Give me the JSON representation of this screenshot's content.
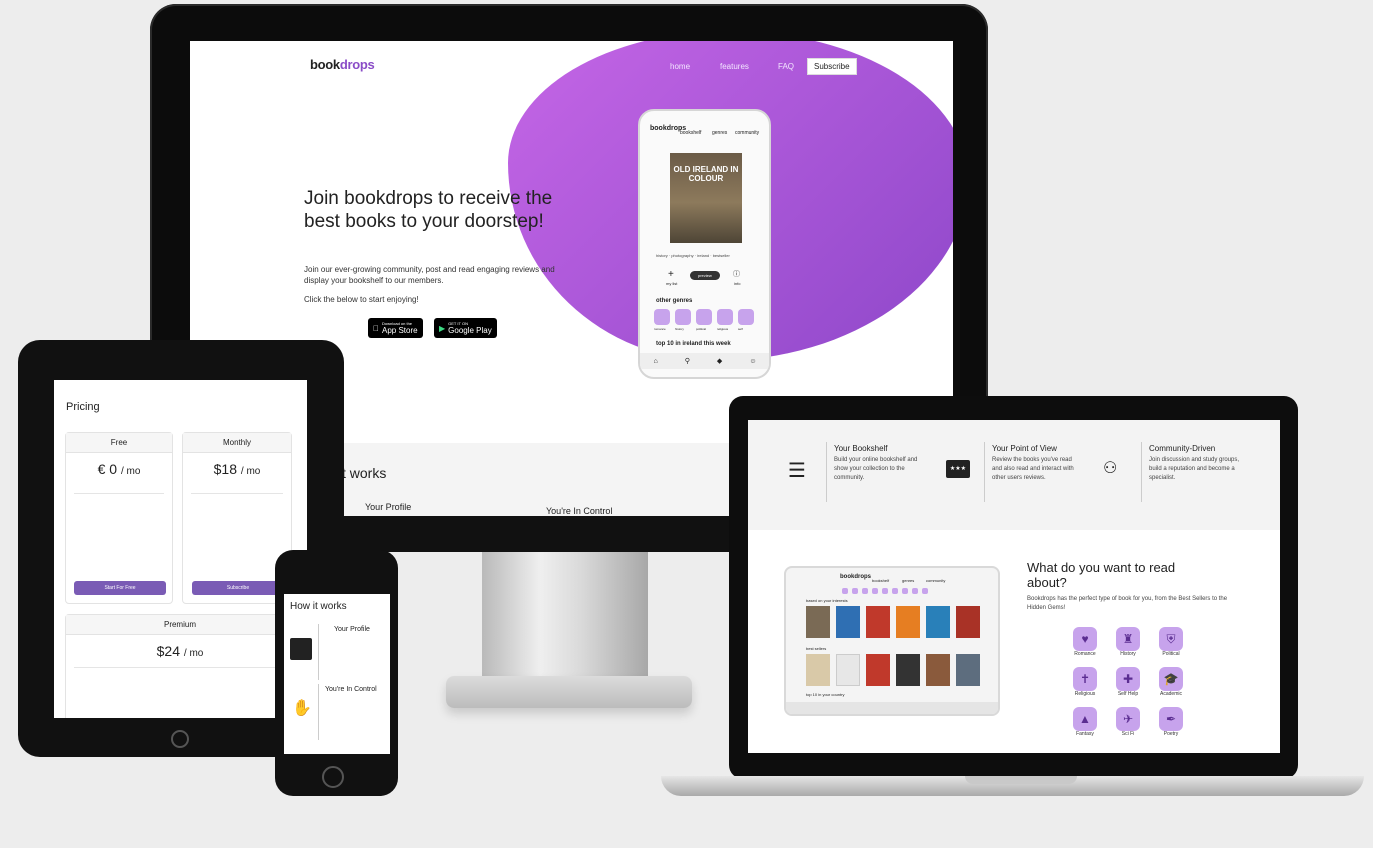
{
  "monitor": {
    "logo_a": "book",
    "logo_b": "drops",
    "nav": [
      "home",
      "features",
      "FAQ"
    ],
    "subscribe": "Subscribe",
    "hero_heading": "Join bookdrops to receive the best books to your doorstep!",
    "hero_text": "Join our ever-growing community, post and read engaging reviews and display your bookshelf to our members.",
    "hero_cta": "Click the below to start enjoying!",
    "app_store": "App Store",
    "app_store_small": "Download on the",
    "google_play": "Google Play",
    "google_play_small": "GET IT ON",
    "section_title": "t works",
    "section_item_1": "Your Profile",
    "section_item_2": "You're In Control",
    "phone": {
      "logo": "bookdrops",
      "tabs": [
        "bookshelf",
        "genres",
        "community"
      ],
      "book_title": "OLD IRELAND IN COLOUR",
      "tags": "history · photography · ireland · bestseller",
      "my_list": "my list",
      "preview": "preview",
      "info": "info",
      "other_genres": "other genres",
      "genres": [
        "romance",
        "history",
        "political",
        "religious",
        "self"
      ],
      "top10": "top 10 in ireland this week"
    }
  },
  "tablet": {
    "title": "Pricing",
    "plans": [
      {
        "name": "Free",
        "price": "€ 0",
        "period": "/ mo",
        "button": "Start For Free"
      },
      {
        "name": "Monthly",
        "price": "$18",
        "period": "/ mo",
        "button": "Subscribe"
      },
      {
        "name": "Premium",
        "price": "$24",
        "period": "/ mo"
      }
    ]
  },
  "phone": {
    "title": "How it works",
    "item_1": "Your Profile",
    "item_2": "You're In Control"
  },
  "laptop": {
    "features": [
      {
        "title": "Your Bookshelf",
        "text": "Build your online bookshelf and show your collection to the community."
      },
      {
        "title": "Your Point of View",
        "text": "Review the books you've read and also read and interact with other users reviews."
      },
      {
        "title": "Community-Driven",
        "text": "Join discussion and study groups, build a reputation and become a specialist."
      }
    ],
    "heading": "What do you want to read about?",
    "text": "Bookdrops has the perfect type of book for you, from the Best Sellers to the Hidden Gems!",
    "genres": [
      "Romance",
      "History",
      "Political",
      "Religious",
      "Self Help",
      "Academic",
      "Fantasy",
      "Sci Fi",
      "Poetry"
    ],
    "ipad": {
      "logo": "bookdrops",
      "tabs": [
        "bookshelf",
        "genres",
        "community"
      ],
      "row1": "based on your interests",
      "row2": "best sellers",
      "row3": "top 10 in your country"
    }
  }
}
